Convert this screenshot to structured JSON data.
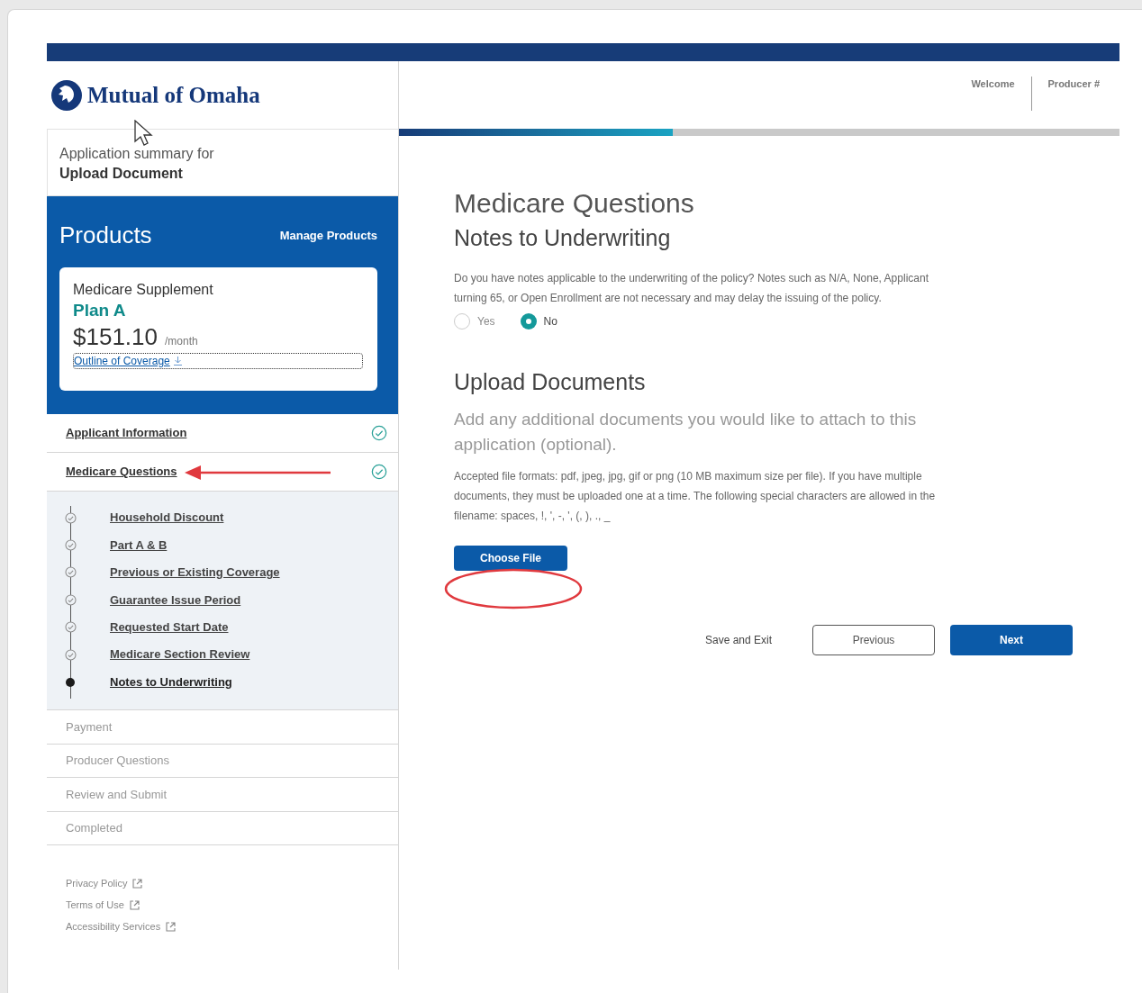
{
  "header": {
    "logo": "Mutual of Omaha",
    "links": [
      "Welcome",
      "Producer #"
    ],
    "progress": {
      "level": 0.38
    }
  },
  "sidebar": {
    "summary_label": "Application summary for",
    "summary_title": "Upload Document",
    "products": {
      "title": "Products",
      "manage": "Manage Products",
      "card": {
        "category": "Medicare Supplement",
        "plan": "Plan A",
        "price": "$151.10",
        "period": "/month",
        "link": "Outline of Coverage"
      }
    },
    "steps": [
      {
        "label": "Applicant Information",
        "completed": true,
        "disabled": false
      },
      {
        "label": "Medicare Questions",
        "completed": true,
        "disabled": false,
        "children": [
          {
            "label": "Household Discount",
            "current": false
          },
          {
            "label": "Part A & B",
            "current": false
          },
          {
            "label": "Previous or Existing Coverage",
            "current": false
          },
          {
            "label": "Guarantee Issue Period",
            "current": false
          },
          {
            "label": "Requested Start Date",
            "current": false
          },
          {
            "label": "Medicare Section Review",
            "current": false
          },
          {
            "label": "Notes to Underwriting",
            "current": true
          }
        ]
      },
      {
        "label": "Payment",
        "completed": false,
        "disabled": true
      },
      {
        "label": "Producer Questions",
        "completed": false,
        "disabled": true
      },
      {
        "label": "Review and Submit",
        "completed": false,
        "disabled": true
      },
      {
        "label": "Completed",
        "completed": false,
        "disabled": true
      }
    ],
    "footer_links": [
      "Privacy Policy",
      "Terms of Use",
      "Accessibility Services"
    ]
  },
  "main": {
    "title": "Medicare Questions",
    "subtitle": "Notes to Underwriting",
    "question": "Do you have notes applicable to the underwriting of the policy? Notes such as N/A, None, Applicant turning 65, or Open Enrollment are not necessary and may delay the issuing of the policy.",
    "options": [
      {
        "label": "Yes",
        "selected": false
      },
      {
        "label": "No",
        "selected": true
      }
    ],
    "upload_title": "Upload Documents",
    "upload_intro": "Add any additional documents you would like to attach to this application (optional).",
    "upload_help": "Accepted file formats: pdf, jpeg, jpg, gif or png (10 MB maximum size per file). If you have multiple documents, they must be uploaded one at a time. The following special characters are allowed in the filename: spaces, !, ', -, ', (, ), ., _",
    "choose_file": "Choose File",
    "actions": [
      {
        "kind": "link",
        "label": "Save and Exit"
      },
      {
        "kind": "secondary",
        "label": "Previous"
      },
      {
        "kind": "primary",
        "label": "Next"
      }
    ]
  }
}
